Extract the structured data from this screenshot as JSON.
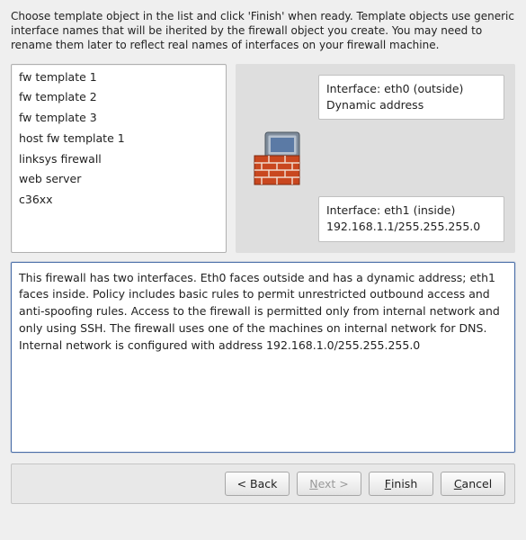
{
  "instructions": "Choose template object in the list and click 'Finish' when ready. Template objects use generic interface names that will be iherited by the firewall object you create. You may need to rename them later to reflect real names of interfaces on your firewall machine.",
  "templates": [
    "fw template 1",
    "fw template 2",
    "fw template 3",
    "host fw template 1",
    "linksys firewall",
    "web server",
    "c36xx"
  ],
  "interfaces": {
    "eth0_label": "Interface: eth0 (outside)",
    "eth0_addr": "Dynamic address",
    "eth1_label": "Interface: eth1 (inside)",
    "eth1_addr": "192.168.1.1/255.255.255.0"
  },
  "description": "This firewall has two interfaces. Eth0 faces outside and has a dynamic address; eth1 faces inside. Policy includes basic rules to permit unrestricted outbound access and anti-spoofing rules. Access to the firewall is permitted only from internal network and only using SSH. The firewall uses one of the machines on internal network for DNS. Internal network is configured with address 192.168.1.0/255.255.255.0",
  "buttons": {
    "back": "< Back",
    "next_pre": "N",
    "next_post": "ext >",
    "finish_pre": "F",
    "finish_post": "inish",
    "cancel_pre": "C",
    "cancel_post": "ancel"
  }
}
